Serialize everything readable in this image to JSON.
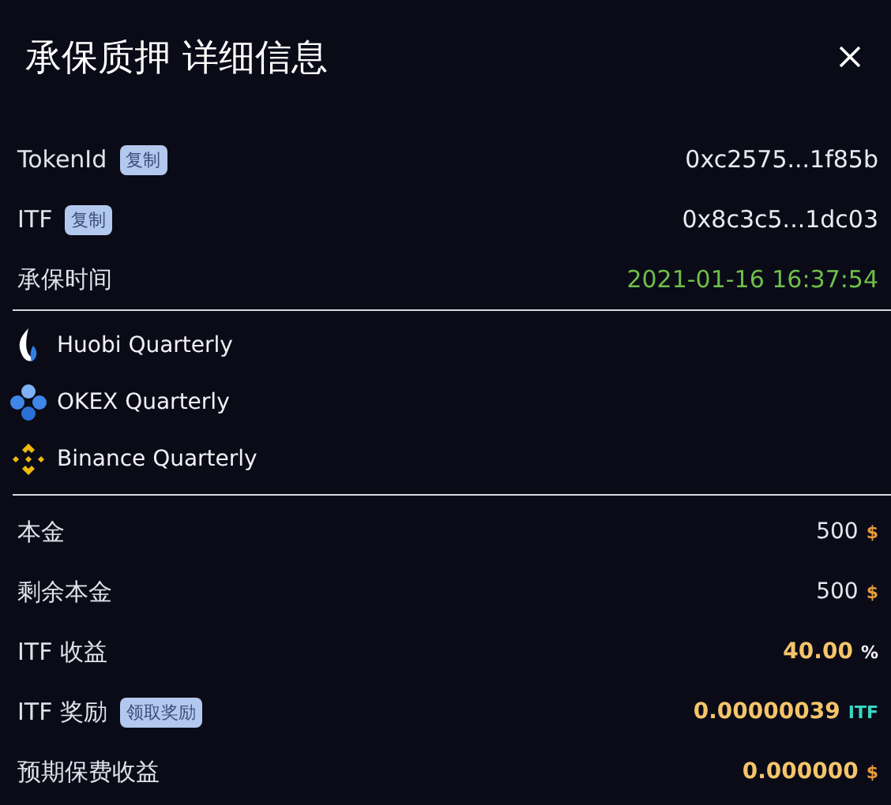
{
  "dialog": {
    "title": "承保质押 详细信息"
  },
  "info_rows": [
    {
      "label": "TokenId",
      "button": "复制",
      "value": "0xc2575...1f85b",
      "kind": "address"
    },
    {
      "label": "ITF",
      "button": "复制",
      "value": "0x8c3c5...1dc03",
      "kind": "address"
    },
    {
      "label": "承保时间",
      "value": "2021-01-16 16:37:54",
      "kind": "time"
    }
  ],
  "exchanges": [
    {
      "name": "Huobi Quarterly",
      "kind": "flame"
    },
    {
      "name": "OKEX Quarterly",
      "kind": "circles"
    },
    {
      "name": "Binance Quarterly",
      "kind": "diamonds"
    }
  ],
  "amounts": [
    {
      "label": "本金",
      "value": "500",
      "unit": "$",
      "kind": "dollar",
      "emphasis": false
    },
    {
      "label": "剩余本金",
      "value": "500",
      "unit": "$",
      "kind": "dollar",
      "emphasis": false
    },
    {
      "label": "ITF 收益",
      "value": "40.00",
      "unit": "%",
      "kind": "percent",
      "emphasis": true
    },
    {
      "label": "ITF 奖励",
      "button": "领取奖励",
      "value": "0.00000039",
      "unit": "ITF",
      "kind": "token",
      "emphasis": true
    },
    {
      "label": "预期保费收益",
      "value": "0.000000",
      "unit": "$",
      "kind": "dollar",
      "emphasis": true
    }
  ]
}
